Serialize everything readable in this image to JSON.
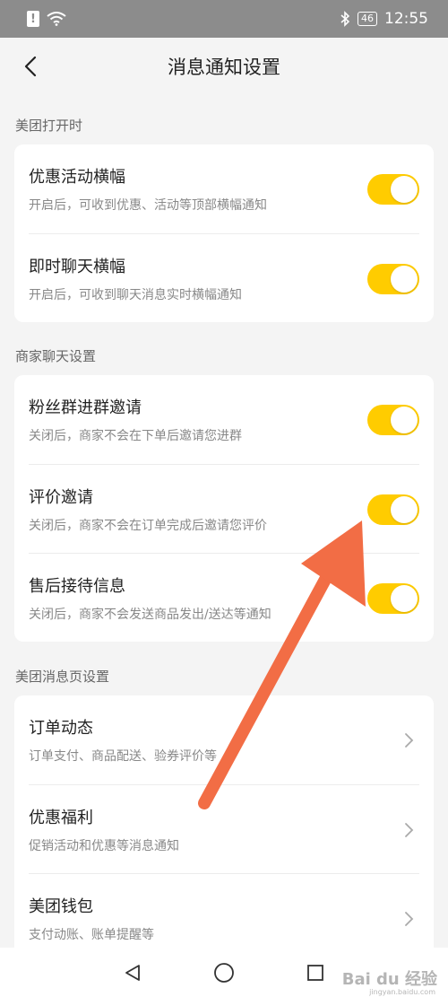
{
  "status_bar": {
    "alert": "!",
    "battery": "46",
    "time": "12:55"
  },
  "header": {
    "title": "消息通知设置"
  },
  "sections": [
    {
      "title": "美团打开时",
      "items": [
        {
          "title": "优惠活动横幅",
          "subtitle": "开启后，可收到优惠、活动等顶部横幅通知",
          "toggle_on": true
        },
        {
          "title": "即时聊天横幅",
          "subtitle": "开启后，可收到聊天消息实时横幅通知",
          "toggle_on": true
        }
      ]
    },
    {
      "title": "商家聊天设置",
      "items": [
        {
          "title": "粉丝群进群邀请",
          "subtitle": "关闭后，商家不会在下单后邀请您进群",
          "toggle_on": true
        },
        {
          "title": "评价邀请",
          "subtitle": "关闭后，商家不会在订单完成后邀请您评价",
          "toggle_on": true
        },
        {
          "title": "售后接待信息",
          "subtitle": "关闭后，商家不会发送商品发出/送达等通知",
          "toggle_on": true
        }
      ]
    },
    {
      "title": "美团消息页设置",
      "items": [
        {
          "title": "订单动态",
          "subtitle": "订单支付、商品配送、验券评价等"
        },
        {
          "title": "优惠福利",
          "subtitle": "促销活动和优惠等消息通知"
        },
        {
          "title": "美团钱包",
          "subtitle": "支付动账、账单提醒等"
        }
      ]
    }
  ],
  "colors": {
    "toggle_on": "#ffcc00",
    "annotation_arrow": "#f26d45"
  },
  "watermark": {
    "brand": "Bai du 经验",
    "sub": "jingyan.baidu.com"
  }
}
